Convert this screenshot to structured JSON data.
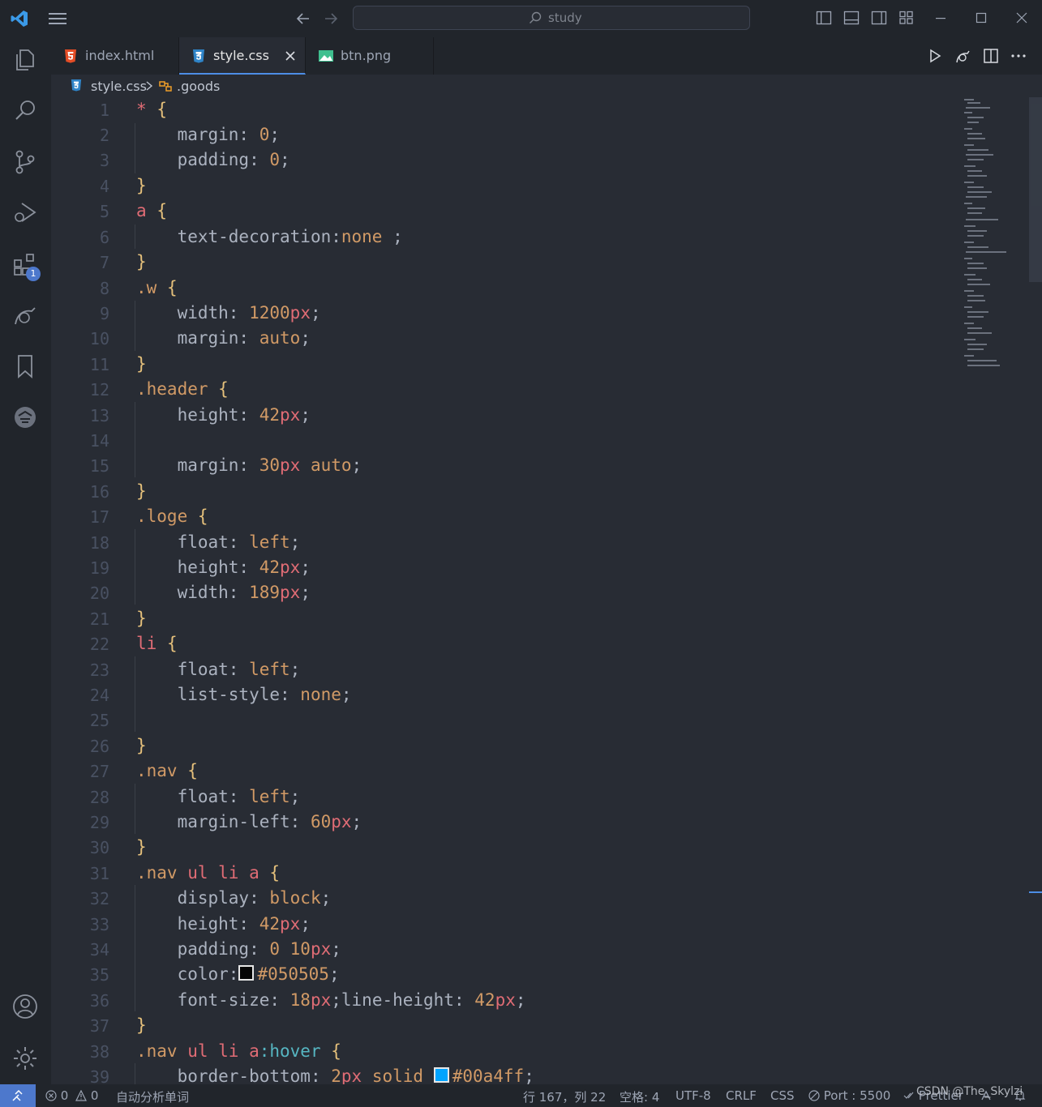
{
  "titlebar": {
    "search_placeholder": "study"
  },
  "activity": {
    "extensions_badge": "1"
  },
  "tabs": [
    {
      "label": "index.html",
      "icon": "html5-icon"
    },
    {
      "label": "style.css",
      "icon": "css3-icon"
    },
    {
      "label": "btn.png",
      "icon": "image-icon"
    }
  ],
  "breadcrumb": {
    "file": "style.css",
    "symbol": ".goods"
  },
  "code": {
    "l1": "1",
    "l2": "2",
    "l3": "3",
    "l4": "4",
    "l5": "5",
    "l6": "6",
    "l7": "7",
    "l8": "8",
    "l9": "9",
    "l10": "10",
    "l11": "11",
    "l12": "12",
    "l13": "13",
    "l14": "14",
    "l15": "15",
    "l16": "16",
    "l17": "17",
    "l18": "18",
    "l19": "19",
    "l20": "20",
    "l21": "21",
    "l22": "22",
    "l23": "23",
    "l24": "24",
    "l25": "25",
    "l26": "26",
    "l27": "27",
    "l28": "28",
    "l29": "29",
    "l30": "30",
    "l31": "31",
    "l32": "32",
    "l33": "33",
    "l34": "34",
    "l35": "35",
    "l36": "36",
    "l37": "37",
    "l38": "38",
    "l39": "39",
    "t1_sel": "*",
    "t1_br": "{",
    "t2_prop": "margin: ",
    "t2_val": "0",
    "t2_end": ";",
    "t3_prop": "padding: ",
    "t3_val": "0",
    "t3_end": ";",
    "t4_br": "}",
    "t5_sel": "a",
    "t5_br": "{",
    "t6_prop": "text-decoration:",
    "t6_val": "none",
    "t6_end": " ;",
    "t7_br": "}",
    "t8_sel": ".w",
    "t8_br": "{",
    "t9_prop": "width: ",
    "t9_val": "1200",
    "t9_unit": "px",
    "t9_end": ";",
    "t10_prop": "margin: ",
    "t10_val": "auto",
    "t10_end": ";",
    "t11_br": "}",
    "t12_sel": ".header",
    "t12_br": "{",
    "t13_prop": "height: ",
    "t13_val": "42",
    "t13_unit": "px",
    "t13_end": ";",
    "t15_prop": "margin: ",
    "t15_val": "30",
    "t15_unit": "px",
    "t15_val2": " auto",
    "t15_end": ";",
    "t16_br": "}",
    "t17_sel": ".loge",
    "t17_br": "{",
    "t18_prop": "float: ",
    "t18_val": "left",
    "t18_end": ";",
    "t19_prop": "height: ",
    "t19_val": "42",
    "t19_unit": "px",
    "t19_end": ";",
    "t20_prop": "width: ",
    "t20_val": "189",
    "t20_unit": "px",
    "t20_end": ";",
    "t21_br": "}",
    "t22_sel": "li",
    "t22_br": "{",
    "t23_prop": "float: ",
    "t23_val": "left",
    "t23_end": ";",
    "t24_prop": "list-style: ",
    "t24_val": "none",
    "t24_end": ";",
    "t26_br": "}",
    "t27_sel": ".nav",
    "t27_br": "{",
    "t28_prop": "float: ",
    "t28_val": "left",
    "t28_end": ";",
    "t29_prop": "margin-left: ",
    "t29_val": "60",
    "t29_unit": "px",
    "t29_end": ";",
    "t30_br": "}",
    "t31_sel": ".nav",
    "t31_tag": " ul li a",
    "t31_br": "{",
    "t32_prop": "display: ",
    "t32_val": "block",
    "t32_end": ";",
    "t33_prop": "height: ",
    "t33_val": "42",
    "t33_unit": "px",
    "t33_end": ";",
    "t34_prop": "padding: ",
    "t34_val": "0 10",
    "t34_unit": "px",
    "t34_end": ";",
    "t35_prop": "color:",
    "t35_val": "#050505",
    "t35_end": ";",
    "t36_prop": "font-size: ",
    "t36_val": "18",
    "t36_unit": "px",
    "t36_mid": ";line-height: ",
    "t36_val2": "42",
    "t36_unit2": "px",
    "t36_end": ";",
    "t37_br": "}",
    "t38_sel": ".nav",
    "t38_tag": " ul li a",
    "t38_pseudo": ":hover",
    "t38_br": "{",
    "t39_prop": "border-bottom: ",
    "t39_val": "2",
    "t39_unit": "px",
    "t39_val2": " solid ",
    "t39_color": "#00a4ff",
    "t39_end": ";"
  },
  "colors": {
    "swatch_black": "#050505",
    "swatch_blue": "#00a4ff",
    "accent": "#4d8ee6"
  },
  "status": {
    "errors": "0",
    "warnings": "0",
    "ext_label": "自动分析单词",
    "position": "行 167，列 22",
    "spaces": "空格: 4",
    "encoding": "UTF-8",
    "eol": "CRLF",
    "language": "CSS",
    "port": "Port : 5500",
    "prettier": "Prettier",
    "watermark": "CSDN @The_Skylzi"
  }
}
